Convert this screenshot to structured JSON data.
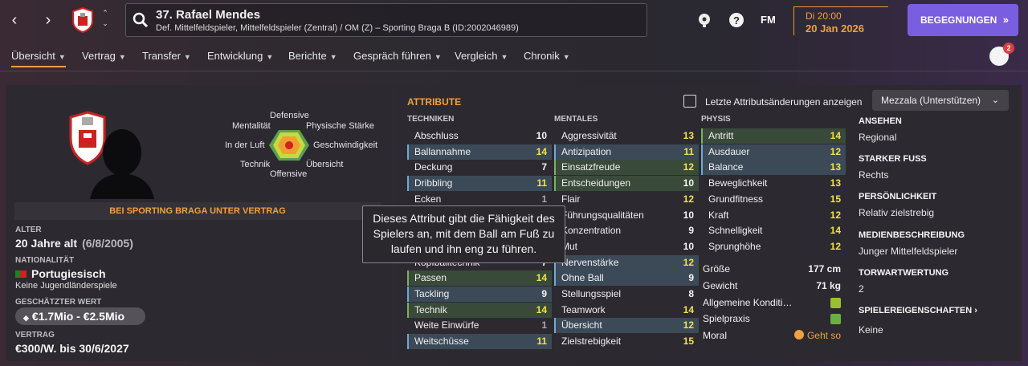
{
  "header": {
    "player_name": "37. Rafael Mendes",
    "player_desc": "Def. Mittelfeldspieler, Mittelfeldspieler (Zentral) / OM (Z) – Sporting Braga B (ID:2002046989)",
    "fm_label": "FM",
    "date_time": "Di 20:00",
    "date": "20 Jan 2026",
    "continue_button": "BEGEGNUNGEN",
    "notifications": "2"
  },
  "menu": {
    "items": [
      "Übersicht",
      "Vertrag",
      "Transfer",
      "Entwicklung",
      "Berichte",
      "Gespräch führen",
      "Vergleich",
      "Chronik"
    ]
  },
  "profile": {
    "contract_banner": "BEI SPORTING BRAGA UNTER VERTRAG",
    "age_label": "ALTER",
    "age": "20 Jahre alt",
    "birthdate": "(6/8/2005)",
    "nationality_label": "NATIONALITÄT",
    "nationality": "Portugiesisch",
    "nationality_note": "Keine Jugendländerspiele",
    "value_label": "GESCHÄTZTER WERT",
    "value": "€1.7Mio - €2.5Mio",
    "contract_label": "VERTRAG",
    "contract": "€300/W. bis 30/6/2027"
  },
  "pitch_labels": {
    "defensive": "Defensive",
    "mentality": "Mentalität",
    "physical": "Physische Stärke",
    "aerial": "In der Luft",
    "speed": "Geschwindigkeit",
    "technique": "Technik",
    "vision": "Übersicht",
    "offensive": "Offensive"
  },
  "attributes": {
    "title": "ATTRIBUTE",
    "show_changes": "Letzte Attributsänderungen anzeigen",
    "role": "Mezzala (Unterstützen)",
    "technical_head": "TECHNIKEN",
    "mental_head": "MENTALES",
    "physical_head": "PHYSIS",
    "technical": [
      {
        "n": "Abschluss",
        "v": "10",
        "s": "plain"
      },
      {
        "n": "Ballannahme",
        "v": "14",
        "s": "blue"
      },
      {
        "n": "Deckung",
        "v": "7",
        "s": "plain"
      },
      {
        "n": "Dribbling",
        "v": "11",
        "s": "blue"
      },
      {
        "n": "Ecken",
        "v": "1",
        "s": "plain"
      },
      {
        "n": "",
        "v": "",
        "s": "plain"
      },
      {
        "n": "",
        "v": "",
        "s": "plain"
      },
      {
        "n": "",
        "v": "",
        "s": "plain"
      },
      {
        "n": "Kopfballtechnik",
        "v": "7",
        "s": "plain"
      },
      {
        "n": "Passen",
        "v": "14",
        "s": "green"
      },
      {
        "n": "Tackling",
        "v": "9",
        "s": "blue"
      },
      {
        "n": "Technik",
        "v": "14",
        "s": "green"
      },
      {
        "n": "Weite Einwürfe",
        "v": "1",
        "s": "plain"
      },
      {
        "n": "Weitschüsse",
        "v": "11",
        "s": "blue"
      }
    ],
    "mental": [
      {
        "n": "Aggressivität",
        "v": "13",
        "s": "plain"
      },
      {
        "n": "Antizipation",
        "v": "11",
        "s": "blue"
      },
      {
        "n": "Einsatzfreude",
        "v": "12",
        "s": "green"
      },
      {
        "n": "Entscheidungen",
        "v": "10",
        "s": "green"
      },
      {
        "n": "Flair",
        "v": "12",
        "s": "plain"
      },
      {
        "n": "Führungsqualitäten",
        "v": "10",
        "s": "plain"
      },
      {
        "n": "Konzentration",
        "v": "9",
        "s": "plain"
      },
      {
        "n": "Mut",
        "v": "10",
        "s": "plain"
      },
      {
        "n": "Nervenstärke",
        "v": "12",
        "s": "blue"
      },
      {
        "n": "Ohne Ball",
        "v": "9",
        "s": "blue"
      },
      {
        "n": "Stellungsspiel",
        "v": "8",
        "s": "plain"
      },
      {
        "n": "Teamwork",
        "v": "14",
        "s": "plain"
      },
      {
        "n": "Übersicht",
        "v": "12",
        "s": "blue"
      },
      {
        "n": "Zielstrebigkeit",
        "v": "15",
        "s": "plain"
      }
    ],
    "physical": [
      {
        "n": "Antritt",
        "v": "14",
        "s": "green"
      },
      {
        "n": "Ausdauer",
        "v": "12",
        "s": "blue"
      },
      {
        "n": "Balance",
        "v": "13",
        "s": "blue"
      },
      {
        "n": "Beweglichkeit",
        "v": "13",
        "s": "plain"
      },
      {
        "n": "Grundfitness",
        "v": "15",
        "s": "plain"
      },
      {
        "n": "Kraft",
        "v": "12",
        "s": "plain"
      },
      {
        "n": "Schnelligkeit",
        "v": "14",
        "s": "plain"
      },
      {
        "n": "Sprunghöhe",
        "v": "12",
        "s": "plain"
      }
    ],
    "extras": {
      "height_label": "Größe",
      "height": "177 cm",
      "weight_label": "Gewicht",
      "weight": "71 kg",
      "condition_label": "Allgemeine Konditi…",
      "match_practice_label": "Spielpraxis",
      "morale_label": "Moral",
      "morale": "Geht so"
    }
  },
  "info": {
    "reputation_label": "ANSEHEN",
    "reputation": "Regional",
    "foot_label": "STARKER FUSS",
    "foot": "Rechts",
    "personality_label": "PERSÖNLICHKEIT",
    "personality": "Relativ zielstrebig",
    "media_label": "MEDIENBESCHREIBUNG",
    "media": "Junger Mittelfeldspieler",
    "gk_label": "TORWARTWERTUNG",
    "gk": "2",
    "traits_label": "SPIELEREIGENSCHAFTEN",
    "traits": "Keine"
  },
  "tooltip": "Dieses Attribut gibt die Fähigkeit des Spielers an, mit dem Ball am Fuß zu laufen und ihn eng zu führen.",
  "colors": {
    "accent": "#f0a040",
    "button": "#7a5ee0",
    "highlight": "#f2e24a"
  }
}
